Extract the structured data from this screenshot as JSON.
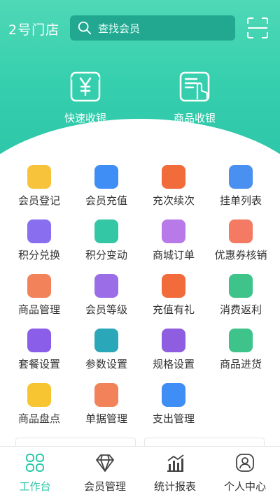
{
  "header": {
    "store_name": "2号门店",
    "search_placeholder": "查找会员"
  },
  "quick_actions": [
    {
      "label": "快速收银",
      "icon": "yen-icon"
    },
    {
      "label": "商品收银",
      "icon": "touch-list-icon"
    }
  ],
  "menu": [
    {
      "label": "会员登记",
      "icon": "register-icon",
      "color": "#f6c33a"
    },
    {
      "label": "会员充值",
      "icon": "card-icon",
      "color": "#3f8ef5"
    },
    {
      "label": "充次续次",
      "icon": "count-icon",
      "color": "#f26b3a"
    },
    {
      "label": "挂单列表",
      "icon": "clipboard-icon",
      "color": "#4a90f0"
    },
    {
      "label": "积分兑换",
      "icon": "gift-icon",
      "color": "#8a6ef0"
    },
    {
      "label": "积分变动",
      "icon": "points-icon",
      "color": "#34c7a6"
    },
    {
      "label": "商城订单",
      "icon": "order-icon",
      "color": "#b77ae8"
    },
    {
      "label": "优惠券核销",
      "icon": "coupon-icon",
      "color": "#f47a63"
    },
    {
      "label": "商品管理",
      "icon": "box-icon",
      "color": "#f2825a"
    },
    {
      "label": "会员等级",
      "icon": "crown-icon",
      "color": "#9b6ee8"
    },
    {
      "label": "充值有礼",
      "icon": "bow-icon",
      "color": "#f26b3a"
    },
    {
      "label": "消费返利",
      "icon": "percent-icon",
      "color": "#3ec48b"
    },
    {
      "label": "套餐设置",
      "icon": "basket-icon",
      "color": "#8a5ee8"
    },
    {
      "label": "参数设置",
      "icon": "sliders-icon",
      "color": "#2aa7b8"
    },
    {
      "label": "规格设置",
      "icon": "ruler-icon",
      "color": "#8f5ee0"
    },
    {
      "label": "商品进货",
      "icon": "truck-icon",
      "color": "#3ec48b"
    },
    {
      "label": "商品盘点",
      "icon": "inventory-icon",
      "color": "#f7c531"
    },
    {
      "label": "单据管理",
      "icon": "folder-icon",
      "color": "#f2825a"
    },
    {
      "label": "支出管理",
      "icon": "shirt-icon",
      "color": "#3f8ef5"
    }
  ],
  "nav": [
    {
      "label": "工作台",
      "icon": "workbench-icon",
      "active": true
    },
    {
      "label": "会员管理",
      "icon": "diamond-icon",
      "active": false
    },
    {
      "label": "统计报表",
      "icon": "stats-icon",
      "active": false
    },
    {
      "label": "个人中心",
      "icon": "user-icon",
      "active": false
    }
  ],
  "colors": {
    "accent": "#2ec7a9"
  }
}
